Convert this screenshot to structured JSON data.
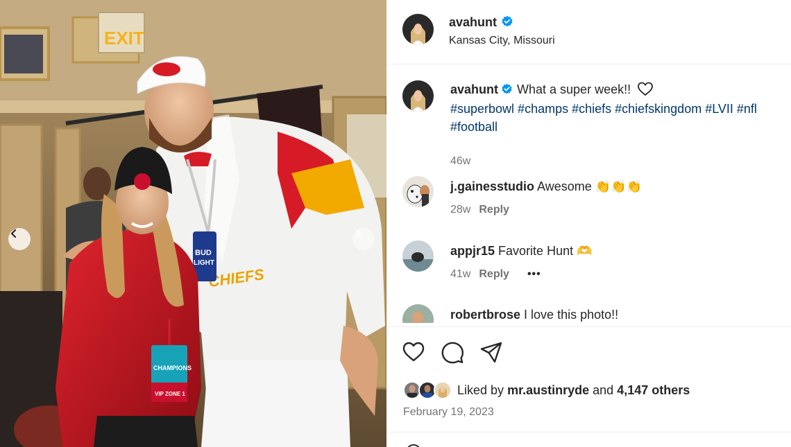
{
  "photo": {
    "exit_sign": "EXIT",
    "can_label_top": "BUD",
    "can_label_bottom": "LIGHT",
    "jacket_text": "CHIEFS",
    "badge_top": "CHAMPIONS",
    "badge_bottom": "VIP ZONE 1",
    "prev_icon": "chevron-left-icon",
    "next_icon": "chevron-right-icon"
  },
  "header": {
    "username": "avahunt",
    "location": "Kansas City, Missouri",
    "verified_icon": "verified-badge-icon"
  },
  "caption": {
    "username": "avahunt",
    "text": "What a super week!!",
    "hashtags_line1": "#superbowl #champs #chiefs #chiefskingdom #LVII #nfl",
    "hashtags_line2": "#football",
    "time": "46w"
  },
  "comments": [
    {
      "username": "j.gainesstudio",
      "text": "Awesome 👏👏👏",
      "time": "28w",
      "reply_label": "Reply"
    },
    {
      "username": "appjr15",
      "text": "Favorite Hunt 🫶",
      "time": "41w",
      "reply_label": "Reply",
      "more_label": "•••"
    },
    {
      "username": "robertbrose",
      "text": "I love this photo!!"
    }
  ],
  "actions": {
    "like_icon": "heart-icon",
    "comment_icon": "comment-icon",
    "share_icon": "share-icon"
  },
  "likes": {
    "prefix": "Liked by",
    "first_liker": "mr.austinryde",
    "middle": "and",
    "others": "4,147 others"
  },
  "post_date": "February 19, 2023",
  "colors": {
    "hashtag": "#00376b",
    "verified": "#0095f6",
    "secondary_text": "#737373",
    "jacket_red": "#c8102e",
    "jacket_yellow": "#f2a900"
  }
}
